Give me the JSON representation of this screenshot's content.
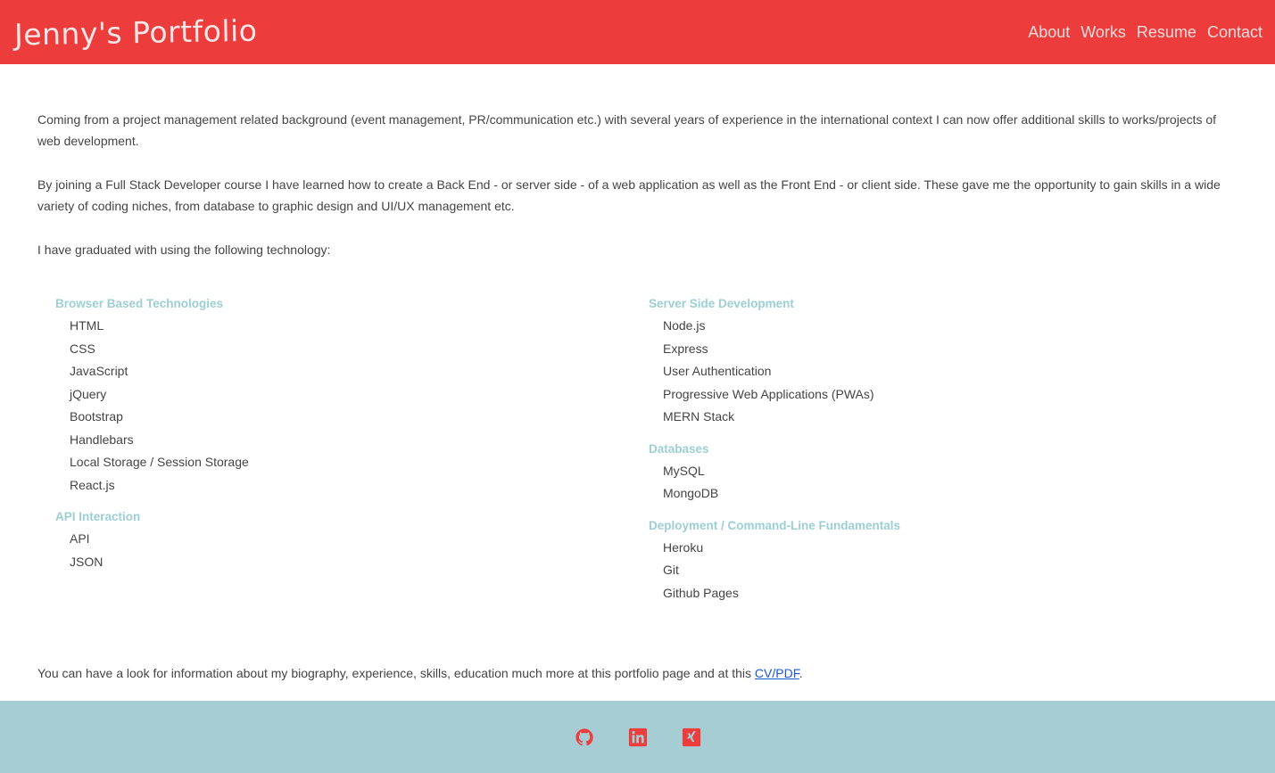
{
  "header": {
    "brand": "Jenny's Portfolio",
    "nav": [
      "About",
      "Works",
      "Resume",
      "Contact"
    ],
    "accent_color": "#ec3c3c"
  },
  "main": {
    "intro": "Coming from a project management related background (event management, PR/communication etc.) with several years of experience in the international context I can now offer additional skills to works/projects of web development.",
    "course": "By joining a Full Stack Developer course I have learned how to create a Back End - or server side - of a web application as well as the Front End - or client side. These gave me the opportunity to gain skills in a wide variety of coding niches, from database to graphic design and UI/UX management etc.",
    "graduated": "I have graduated with using the following technology:",
    "left_groups": [
      {
        "title": "Browser Based Technologies",
        "items": [
          "HTML",
          "CSS",
          "JavaScript",
          "jQuery",
          "Bootstrap",
          "Handlebars",
          "Local Storage / Session Storage",
          "React.js"
        ]
      },
      {
        "title": "API Interaction",
        "items": [
          "API",
          "JSON"
        ]
      }
    ],
    "right_groups": [
      {
        "title": "Server Side Development",
        "items": [
          "Node.js",
          "Express",
          "User Authentication",
          "Progressive Web Applications (PWAs)",
          "MERN Stack"
        ]
      },
      {
        "title": "Databases",
        "items": [
          "MySQL",
          "MongoDB"
        ]
      },
      {
        "title": "Deployment / Command-Line Fundamentals",
        "items": [
          "Heroku",
          "Git",
          "Github Pages"
        ]
      }
    ],
    "closing_text": "You can have a look for information about my biography, experience, skills, education much more at this portfolio page and at this ",
    "closing_link": "CV/PDF",
    "closing_end": "."
  },
  "footer": {
    "icons": [
      "github-icon",
      "linkedin-icon",
      "xing-icon"
    ],
    "icon_color": "#ec3c3c",
    "background": "#a6cdd3"
  }
}
